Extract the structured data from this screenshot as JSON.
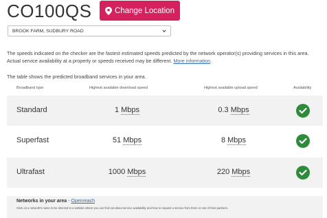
{
  "header": {
    "postcode": "CO100QS",
    "change_location_label": "Change Location"
  },
  "address_select": {
    "selected": "BROOK FARM, SUDBURY ROAD"
  },
  "info": {
    "text": "The speeds indicated on the checker are the fastest estimated speeds predicted by the network operator(s) providing services in this area. Actual service availability at a property or speeds received may be different. ",
    "link": "More information",
    "after_link": "."
  },
  "table": {
    "intro": "The table shows the predicted broadband services in your area.",
    "headers": {
      "type": "Broadband type",
      "download": "Highest available download speed",
      "upload": "Highest available upload speed",
      "availability": "Availability"
    },
    "rows": [
      {
        "type": "Standard",
        "down_value": "1",
        "down_unit": "Mbps",
        "up_value": "0.3",
        "up_unit": "Mbps",
        "available": true
      },
      {
        "type": "Superfast",
        "down_value": "51",
        "down_unit": "Mbps",
        "up_value": "8",
        "up_unit": "Mbps",
        "available": true
      },
      {
        "type": "Ultrafast",
        "down_value": "1000",
        "down_unit": "Mbps",
        "up_value": "220",
        "up_unit": "Mbps",
        "available": true
      }
    ]
  },
  "networks": {
    "title": "Networks in your area",
    "separator": " - ",
    "provider": "Openreach",
    "description": "Click on a network's name to be directed to a website where you can find out about service availability and how to request a service from them or one of their partners."
  },
  "colors": {
    "accent": "#d6215f",
    "check": "#2e8b3c",
    "link": "#2a6ebb"
  }
}
